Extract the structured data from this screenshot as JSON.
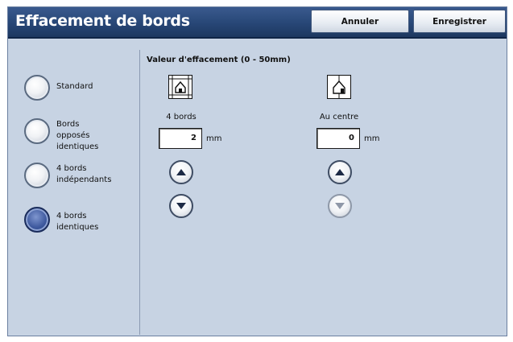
{
  "header": {
    "title": "Effacement de bords",
    "cancel_label": "Annuler",
    "save_label": "Enregistrer"
  },
  "options": [
    {
      "label_lines": [
        "Standard"
      ],
      "selected": false
    },
    {
      "label_lines": [
        "Bords opposés",
        "identiques"
      ],
      "selected": false
    },
    {
      "label_lines": [
        "4 bords",
        "indépendants"
      ],
      "selected": false
    },
    {
      "label_lines": [
        "4 bords identiques"
      ],
      "selected": true
    }
  ],
  "main": {
    "section_label": "Valeur d'effacement (0 - 50mm)",
    "all_edges": {
      "label": "4 bords",
      "value": "2",
      "unit": "mm",
      "icon": "four-edges-icon"
    },
    "center": {
      "label": "Au centre",
      "value": "0",
      "unit": "mm",
      "icon": "center-erase-icon",
      "down_disabled": true
    }
  },
  "colors": {
    "header": "#274676",
    "panel": "#c7d3e3",
    "radio_selected": "#3f5a9f"
  }
}
